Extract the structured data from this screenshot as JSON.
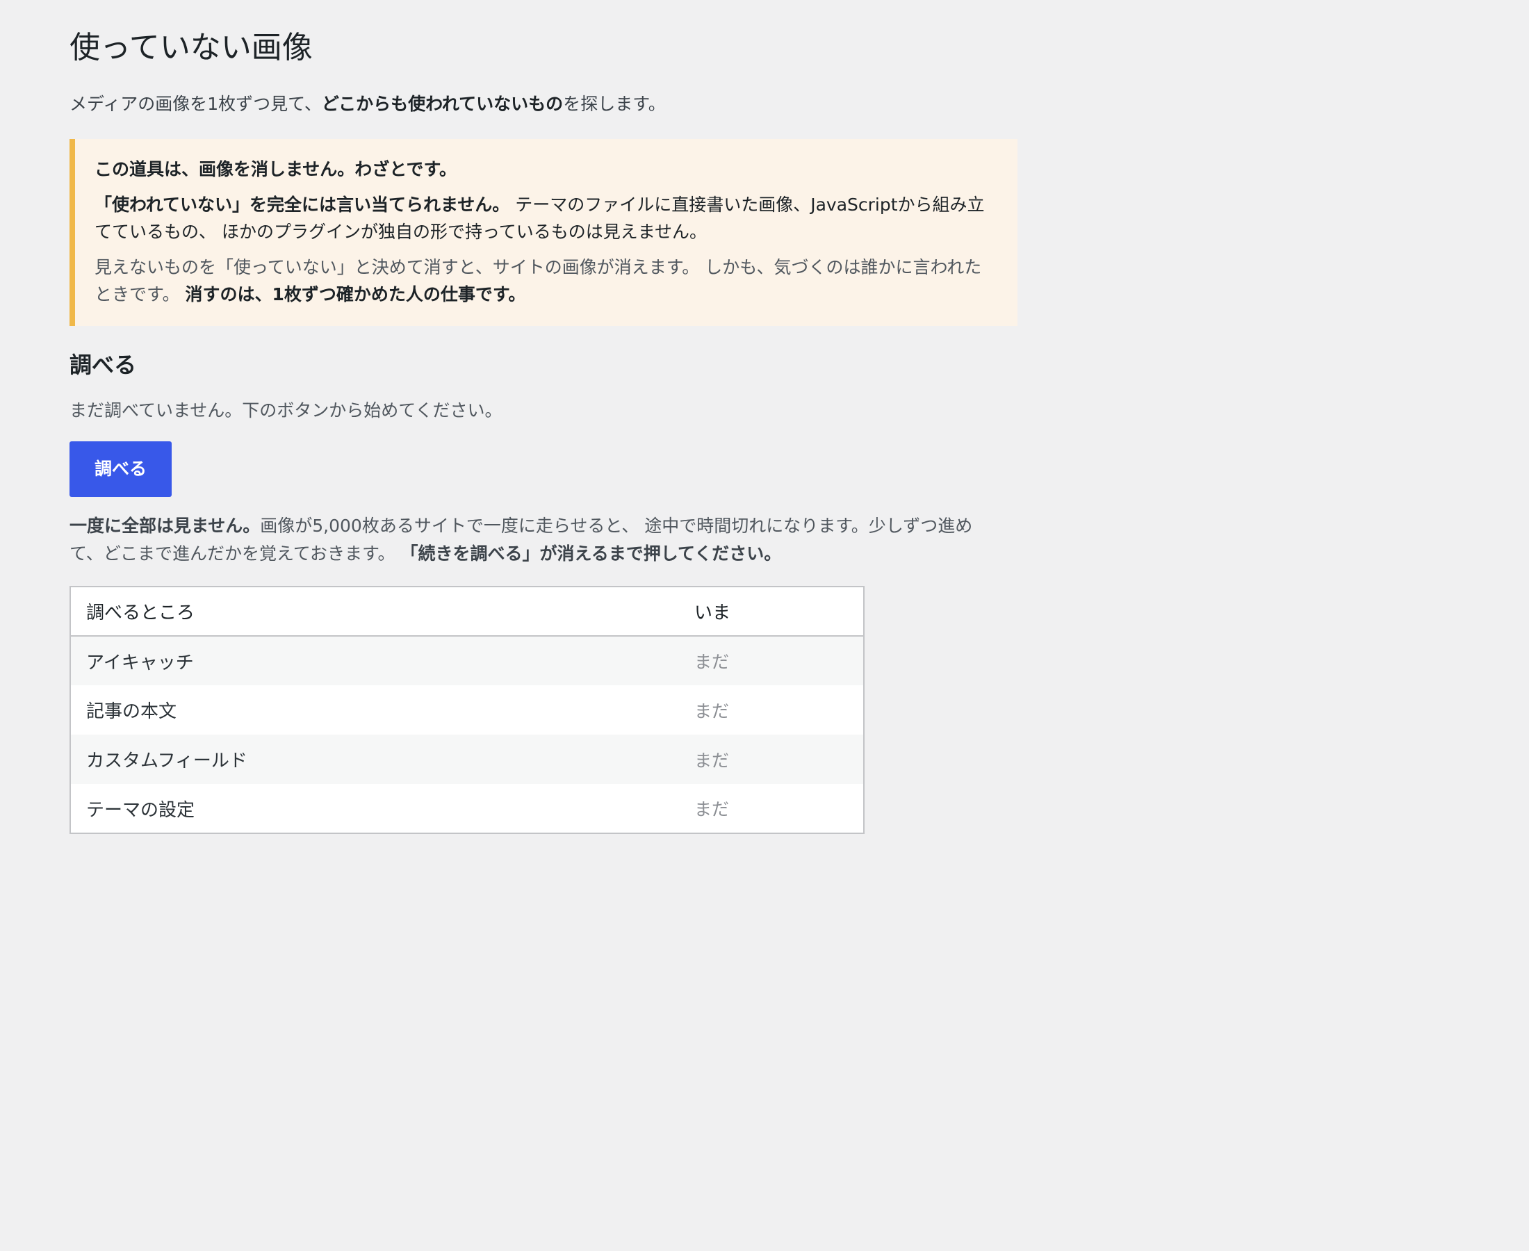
{
  "page": {
    "title": "使っていない画像",
    "lead": {
      "prefix": "メディアの画像を1枚ずつ見て、",
      "bold": "どこからも使われていないもの",
      "suffix": "を探します。"
    }
  },
  "notice": {
    "title": "この道具は、画像を消しません。わざとです。",
    "para1_bold": "「使われていない」を完全には言い当てられません。",
    "para1_text": " テーマのファイルに直接書いた画像、JavaScriptから組み立てているもの、 ほかのプラグインが独自の形で持っているものは見えません。",
    "para2_text": "見えないものを「使っていない」と決めて消すと、サイトの画像が消えます。 しかも、気づくのは誰かに言われたときです。 ",
    "para2_bold": "消すのは、1枚ずつ確かめた人の仕事です。",
    "accent_color": "#f0b849",
    "background_color": "#fcf3e8"
  },
  "scan": {
    "heading": "調べる",
    "status": "まだ調べていません。下のボタンから始めてください。",
    "button_label": "調べる",
    "button_color": "#3858e9",
    "note_bold1": "一度に全部は見ません。",
    "note_text": "画像が5,000枚あるサイトで一度に走らせると、 途中で時間切れになります。少しずつ進めて、どこまで進んだかを覚えておきます。 ",
    "note_bold2": "「続きを調べる」が消えるまで押してください。"
  },
  "table": {
    "headers": [
      "調べるところ",
      "いま"
    ],
    "rows": [
      {
        "place": "アイキャッチ",
        "state": "まだ"
      },
      {
        "place": "記事の本文",
        "state": "まだ"
      },
      {
        "place": "カスタムフィールド",
        "state": "まだ"
      },
      {
        "place": "テーマの設定",
        "state": "まだ"
      }
    ]
  }
}
